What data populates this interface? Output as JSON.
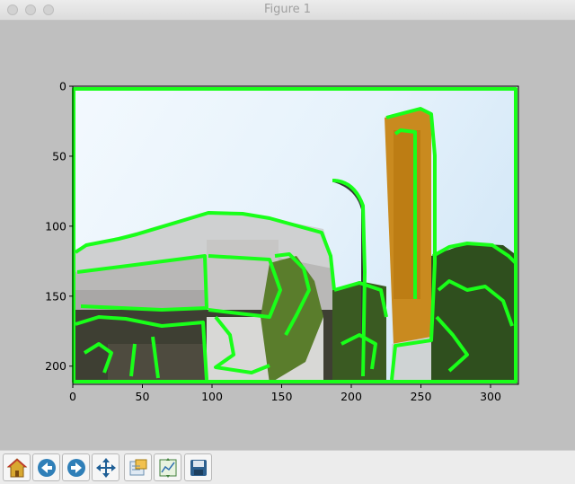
{
  "window": {
    "title": "Figure 1"
  },
  "chart_data": {
    "type": "image",
    "x_ticks": [
      0,
      50,
      100,
      150,
      200,
      250,
      300
    ],
    "y_ticks": [
      0,
      50,
      100,
      150,
      200
    ],
    "xlim": [
      0,
      320
    ],
    "ylim": [
      213,
      0
    ]
  },
  "toolbar": {
    "buttons": [
      {
        "name": "home-button",
        "icon": "home-icon"
      },
      {
        "name": "back-button",
        "icon": "back-arrow-icon"
      },
      {
        "name": "forward-button",
        "icon": "forward-arrow-icon"
      },
      {
        "name": "pan-button",
        "icon": "move-icon"
      },
      {
        "name": "zoom-button",
        "icon": "zoom-rect-icon"
      },
      {
        "name": "subplots-button",
        "icon": "subplots-icon"
      },
      {
        "name": "save-button",
        "icon": "save-icon"
      }
    ]
  },
  "colors": {
    "contour": "#19ff19",
    "sky": "#e6f2fb",
    "tower": "#c98a1f"
  }
}
